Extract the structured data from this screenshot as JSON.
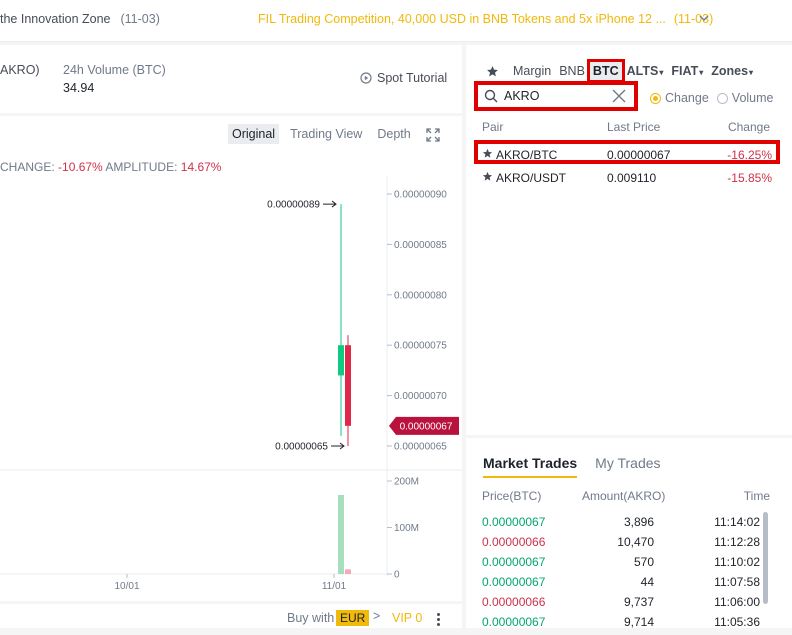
{
  "topbar": {
    "left_text": "the Innovation Zone",
    "left_date": "(11-03)",
    "right_text": "FIL Trading Competition, 40,000 USD in BNB Tokens and 5x iPhone 12 ...",
    "right_date": "(11-03)"
  },
  "ticker": {
    "pair_fragment": "AKRO)",
    "volume_label": "24h Volume (BTC)",
    "volume_value": "34.94",
    "tutorial_label": "Spot Tutorial"
  },
  "chart_tabs": [
    "Original",
    "Trading View",
    "Depth"
  ],
  "change_line": {
    "change_label": "CHANGE:",
    "change_value": "-10.67%",
    "amplitude_label": "AMPLITUDE:",
    "amplitude_value": "14.67%"
  },
  "chart_data": {
    "type": "candlestick",
    "price_ticks": [
      "0.00000090",
      "0.00000085",
      "0.00000080",
      "0.00000075",
      "0.00000070",
      "0.00000065"
    ],
    "high_label": "0.00000089",
    "low_label": "0.00000065",
    "last_price_label": "0.00000067",
    "volume_ticks": [
      "200M",
      "100M",
      "0"
    ],
    "x_ticks": [
      "10/01",
      "11/01"
    ],
    "candles": [
      {
        "open": 7.2e-07,
        "close": 7.5e-07,
        "high": 8.9e-07,
        "low": 6.6e-07,
        "direction": "up"
      },
      {
        "open": 7.5e-07,
        "close": 6.7e-07,
        "high": 7.6e-07,
        "low": 6.5e-07,
        "direction": "down"
      }
    ],
    "volumes_m": [
      170,
      10
    ],
    "ylim": [
      6.3e-07,
      9.1e-07
    ],
    "vol_ylim": [
      0,
      200
    ]
  },
  "bottombar": {
    "buy_with": "Buy with",
    "currency": "EUR",
    "arrow": ">",
    "vip": "VIP 0"
  },
  "market": {
    "categories": [
      {
        "label": "Margin",
        "caret": ""
      },
      {
        "label": "BNB",
        "caret": ""
      },
      {
        "label": "BTC",
        "caret": ""
      },
      {
        "label": "ALTS",
        "caret": "▾"
      },
      {
        "label": "FIAT",
        "caret": "▾"
      },
      {
        "label": "Zones",
        "caret": "▾"
      }
    ],
    "search_value": "AKRO",
    "sort_options": [
      "Change",
      "Volume"
    ],
    "columns": [
      "Pair",
      "Last Price",
      "Change"
    ],
    "rows": [
      {
        "pair": "AKRO/BTC",
        "price": "0.00000067",
        "change": "-16.25%"
      },
      {
        "pair": "AKRO/USDT",
        "price": "0.009110",
        "change": "-15.85%"
      }
    ]
  },
  "trades": {
    "tabs": [
      "Market Trades",
      "My Trades"
    ],
    "columns": [
      "Price(BTC)",
      "Amount(AKRO)",
      "Time"
    ],
    "rows": [
      {
        "price": "0.00000067",
        "amount": "3,896",
        "time": "11:14:02",
        "side": "up"
      },
      {
        "price": "0.00000066",
        "amount": "10,470",
        "time": "11:12:28",
        "side": "dn"
      },
      {
        "price": "0.00000067",
        "amount": "570",
        "time": "11:10:02",
        "side": "up"
      },
      {
        "price": "0.00000067",
        "amount": "44",
        "time": "11:07:58",
        "side": "up"
      },
      {
        "price": "0.00000066",
        "amount": "9,737",
        "time": "11:06:00",
        "side": "dn"
      },
      {
        "price": "0.00000067",
        "amount": "9,714",
        "time": "11:05:36",
        "side": "up"
      }
    ]
  }
}
